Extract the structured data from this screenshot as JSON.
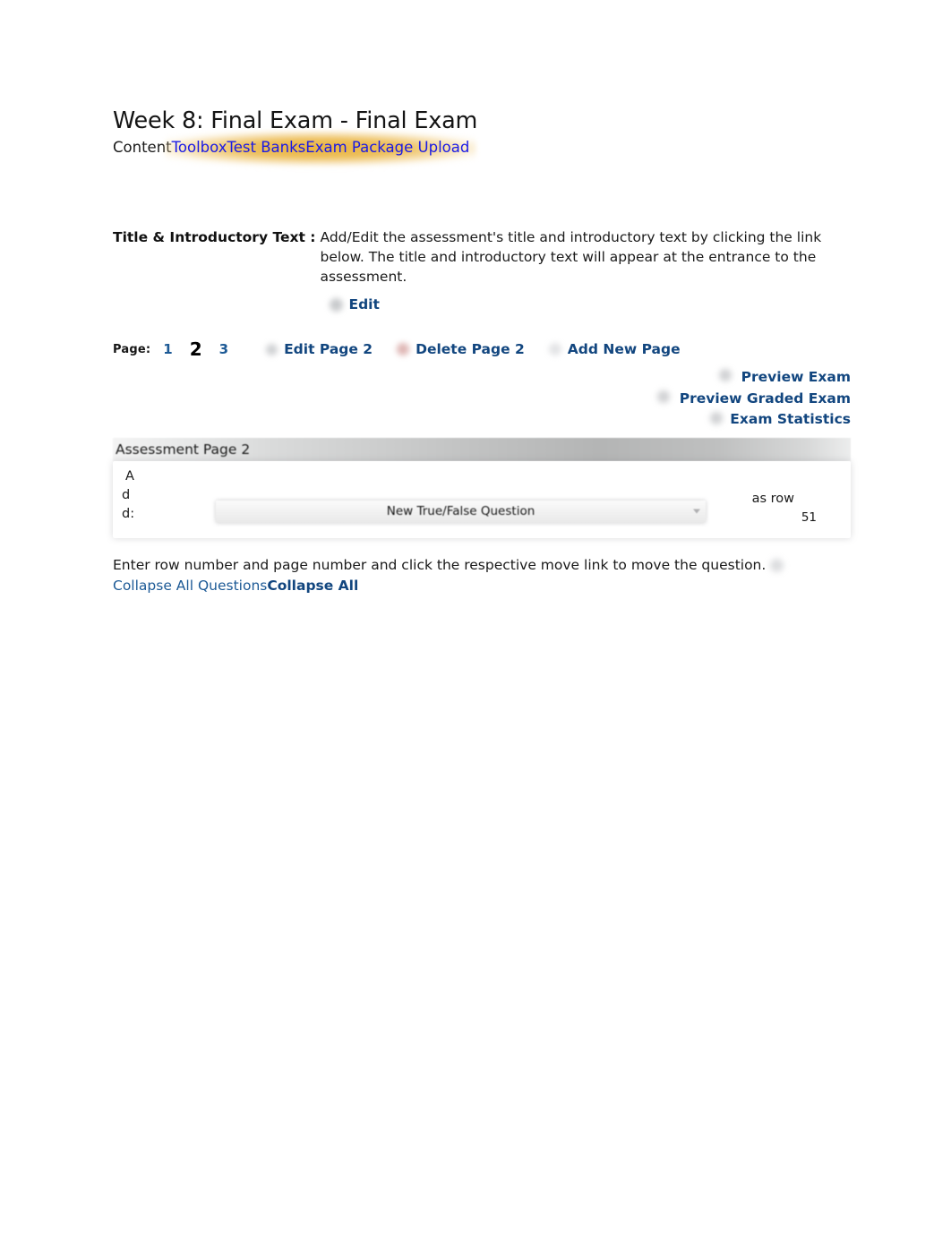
{
  "header": {
    "title": "Week 8: Final Exam - Final Exam",
    "breadcrumb": {
      "static": "Content",
      "links": [
        "Toolbox",
        "Test Banks",
        "Exam Package Upload"
      ]
    }
  },
  "intro": {
    "label": "Title & Introductory Text :",
    "body": "Add/Edit the assessment's title and introductory text by clicking the link below. The title and introductory text will appear at the entrance to the assessment.",
    "edit_link": "Edit",
    "edit_icon": "pencil-icon"
  },
  "page_nav": {
    "label": "Page:",
    "pages": [
      "1",
      "2",
      "3"
    ],
    "current_page": "2",
    "actions": [
      {
        "label": "Edit Page 2",
        "icon": "edit-icon"
      },
      {
        "label": "Delete Page 2",
        "icon": "delete-icon"
      },
      {
        "label": "Add New Page",
        "icon": "add-icon"
      }
    ]
  },
  "right_links": [
    {
      "label": "Preview Exam",
      "icon": "preview-icon"
    },
    {
      "label": "Preview Graded Exam",
      "icon": "preview-graded-icon"
    },
    {
      "label": "Exam Statistics",
      "icon": "statistics-icon"
    }
  ],
  "assessment": {
    "header": "Assessment Page 2",
    "add_label": [
      "A",
      "d",
      "d:"
    ],
    "question_type_selected": "New True/False Question",
    "as_row_label": "as row",
    "row_value": "51"
  },
  "footer": {
    "note": "Enter row number and page number and click the respective move link to move the question.",
    "collapse_plain": "Collapse All Questions",
    "collapse_bold": "Collapse All"
  },
  "colors": {
    "link_blue": "#1a1ae6",
    "link_navy": "#12467f",
    "link_medium_blue": "#1d5a96",
    "highlight_gold": "#e8af34",
    "text": "#1a1a1a"
  }
}
